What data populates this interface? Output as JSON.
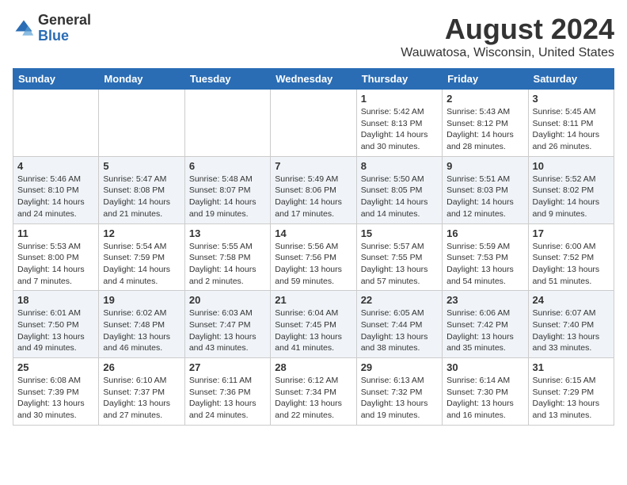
{
  "logo": {
    "general": "General",
    "blue": "Blue"
  },
  "title": "August 2024",
  "location": "Wauwatosa, Wisconsin, United States",
  "days_of_week": [
    "Sunday",
    "Monday",
    "Tuesday",
    "Wednesday",
    "Thursday",
    "Friday",
    "Saturday"
  ],
  "weeks": [
    [
      {
        "day": "",
        "info": ""
      },
      {
        "day": "",
        "info": ""
      },
      {
        "day": "",
        "info": ""
      },
      {
        "day": "",
        "info": ""
      },
      {
        "day": "1",
        "info": "Sunrise: 5:42 AM\nSunset: 8:13 PM\nDaylight: 14 hours\nand 30 minutes."
      },
      {
        "day": "2",
        "info": "Sunrise: 5:43 AM\nSunset: 8:12 PM\nDaylight: 14 hours\nand 28 minutes."
      },
      {
        "day": "3",
        "info": "Sunrise: 5:45 AM\nSunset: 8:11 PM\nDaylight: 14 hours\nand 26 minutes."
      }
    ],
    [
      {
        "day": "4",
        "info": "Sunrise: 5:46 AM\nSunset: 8:10 PM\nDaylight: 14 hours\nand 24 minutes."
      },
      {
        "day": "5",
        "info": "Sunrise: 5:47 AM\nSunset: 8:08 PM\nDaylight: 14 hours\nand 21 minutes."
      },
      {
        "day": "6",
        "info": "Sunrise: 5:48 AM\nSunset: 8:07 PM\nDaylight: 14 hours\nand 19 minutes."
      },
      {
        "day": "7",
        "info": "Sunrise: 5:49 AM\nSunset: 8:06 PM\nDaylight: 14 hours\nand 17 minutes."
      },
      {
        "day": "8",
        "info": "Sunrise: 5:50 AM\nSunset: 8:05 PM\nDaylight: 14 hours\nand 14 minutes."
      },
      {
        "day": "9",
        "info": "Sunrise: 5:51 AM\nSunset: 8:03 PM\nDaylight: 14 hours\nand 12 minutes."
      },
      {
        "day": "10",
        "info": "Sunrise: 5:52 AM\nSunset: 8:02 PM\nDaylight: 14 hours\nand 9 minutes."
      }
    ],
    [
      {
        "day": "11",
        "info": "Sunrise: 5:53 AM\nSunset: 8:00 PM\nDaylight: 14 hours\nand 7 minutes."
      },
      {
        "day": "12",
        "info": "Sunrise: 5:54 AM\nSunset: 7:59 PM\nDaylight: 14 hours\nand 4 minutes."
      },
      {
        "day": "13",
        "info": "Sunrise: 5:55 AM\nSunset: 7:58 PM\nDaylight: 14 hours\nand 2 minutes."
      },
      {
        "day": "14",
        "info": "Sunrise: 5:56 AM\nSunset: 7:56 PM\nDaylight: 13 hours\nand 59 minutes."
      },
      {
        "day": "15",
        "info": "Sunrise: 5:57 AM\nSunset: 7:55 PM\nDaylight: 13 hours\nand 57 minutes."
      },
      {
        "day": "16",
        "info": "Sunrise: 5:59 AM\nSunset: 7:53 PM\nDaylight: 13 hours\nand 54 minutes."
      },
      {
        "day": "17",
        "info": "Sunrise: 6:00 AM\nSunset: 7:52 PM\nDaylight: 13 hours\nand 51 minutes."
      }
    ],
    [
      {
        "day": "18",
        "info": "Sunrise: 6:01 AM\nSunset: 7:50 PM\nDaylight: 13 hours\nand 49 minutes."
      },
      {
        "day": "19",
        "info": "Sunrise: 6:02 AM\nSunset: 7:48 PM\nDaylight: 13 hours\nand 46 minutes."
      },
      {
        "day": "20",
        "info": "Sunrise: 6:03 AM\nSunset: 7:47 PM\nDaylight: 13 hours\nand 43 minutes."
      },
      {
        "day": "21",
        "info": "Sunrise: 6:04 AM\nSunset: 7:45 PM\nDaylight: 13 hours\nand 41 minutes."
      },
      {
        "day": "22",
        "info": "Sunrise: 6:05 AM\nSunset: 7:44 PM\nDaylight: 13 hours\nand 38 minutes."
      },
      {
        "day": "23",
        "info": "Sunrise: 6:06 AM\nSunset: 7:42 PM\nDaylight: 13 hours\nand 35 minutes."
      },
      {
        "day": "24",
        "info": "Sunrise: 6:07 AM\nSunset: 7:40 PM\nDaylight: 13 hours\nand 33 minutes."
      }
    ],
    [
      {
        "day": "25",
        "info": "Sunrise: 6:08 AM\nSunset: 7:39 PM\nDaylight: 13 hours\nand 30 minutes."
      },
      {
        "day": "26",
        "info": "Sunrise: 6:10 AM\nSunset: 7:37 PM\nDaylight: 13 hours\nand 27 minutes."
      },
      {
        "day": "27",
        "info": "Sunrise: 6:11 AM\nSunset: 7:36 PM\nDaylight: 13 hours\nand 24 minutes."
      },
      {
        "day": "28",
        "info": "Sunrise: 6:12 AM\nSunset: 7:34 PM\nDaylight: 13 hours\nand 22 minutes."
      },
      {
        "day": "29",
        "info": "Sunrise: 6:13 AM\nSunset: 7:32 PM\nDaylight: 13 hours\nand 19 minutes."
      },
      {
        "day": "30",
        "info": "Sunrise: 6:14 AM\nSunset: 7:30 PM\nDaylight: 13 hours\nand 16 minutes."
      },
      {
        "day": "31",
        "info": "Sunrise: 6:15 AM\nSunset: 7:29 PM\nDaylight: 13 hours\nand 13 minutes."
      }
    ]
  ]
}
